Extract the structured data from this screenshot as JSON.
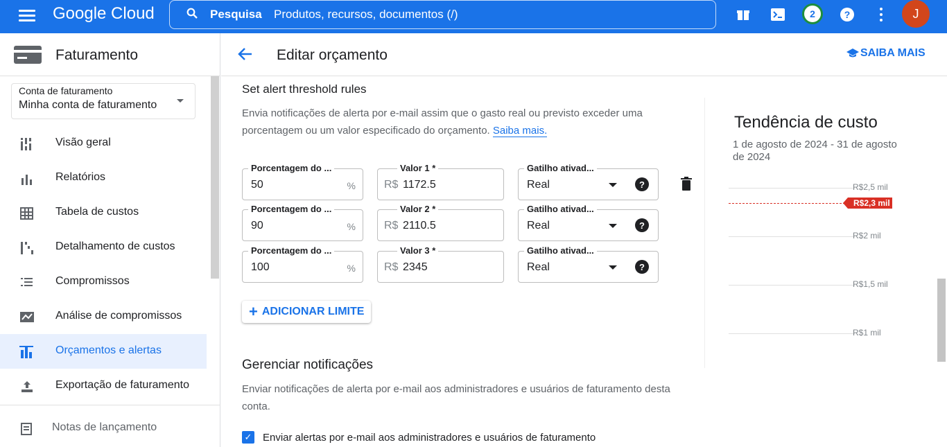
{
  "topbar": {
    "brand": "Google Cloud",
    "search_label": "Pesquisa",
    "search_placeholder": "Produtos, recursos, documentos (/)",
    "notifications_count": "2",
    "avatar_initial": "J"
  },
  "sidebar": {
    "title": "Faturamento",
    "account_label": "Conta de faturamento",
    "account_value": "Minha conta de faturamento",
    "items": [
      {
        "label": "Visão geral",
        "icon": "overview-icon"
      },
      {
        "label": "Relatórios",
        "icon": "reports-icon"
      },
      {
        "label": "Tabela de custos",
        "icon": "cost-table-icon"
      },
      {
        "label": "Detalhamento de custos",
        "icon": "cost-breakdown-icon"
      },
      {
        "label": "Compromissos",
        "icon": "commitments-icon"
      },
      {
        "label": "Análise de compromissos",
        "icon": "commitment-analysis-icon"
      },
      {
        "label": "Orçamentos e alertas",
        "icon": "budgets-icon",
        "active": true
      },
      {
        "label": "Exportação de faturamento",
        "icon": "export-icon"
      },
      {
        "label": "Notas de lançamento",
        "icon": "release-notes-icon"
      }
    ]
  },
  "header": {
    "title": "Editar orçamento",
    "learn_more": "SAIBA MAIS"
  },
  "threshold": {
    "title": "Set alert threshold rules",
    "description": "Envia notificações de alerta por e-mail assim que o gasto real ou previsto exceder uma porcentagem ou um valor especificado do orçamento.",
    "link": "Saiba mais.",
    "rows": [
      {
        "pct_label": "Porcentagem do ...",
        "pct": "50",
        "pct_suffix": "%",
        "val_label": "Valor 1 *",
        "currency": "R$",
        "value": "1172.5",
        "trig_label": "Gatilho ativad...",
        "trigger": "Real"
      },
      {
        "pct_label": "Porcentagem do ...",
        "pct": "90",
        "pct_suffix": "%",
        "val_label": "Valor 2 *",
        "currency": "R$",
        "value": "2110.5",
        "trig_label": "Gatilho ativad...",
        "trigger": "Real"
      },
      {
        "pct_label": "Porcentagem do ...",
        "pct": "100",
        "pct_suffix": "%",
        "val_label": "Valor 3 *",
        "currency": "R$",
        "value": "2345",
        "trig_label": "Gatilho ativad...",
        "trigger": "Real"
      }
    ],
    "add_button": "ADICIONAR LIMITE"
  },
  "notifications": {
    "title": "Gerenciar notificações",
    "description": "Enviar notificações de alerta por e-mail aos administradores e usuários de faturamento desta conta.",
    "checkbox_label": "Enviar alertas por e-mail aos administradores e usuários de faturamento",
    "checkbox_checked": true
  },
  "cost_trend": {
    "title": "Tendência de custo",
    "dates": "1 de agosto de 2024 - 31 de agosto de 2024",
    "gridlines": [
      "R$2,5 mil",
      "R$2 mil",
      "R$1,5 mil",
      "R$1 mil"
    ],
    "budget_marker": "R$2,3 mil",
    "budget_color": "#d93025"
  },
  "colors": {
    "accent": "#1a73e8",
    "avatar": "#d2461b",
    "badge_ring": "#1e8e3e"
  }
}
